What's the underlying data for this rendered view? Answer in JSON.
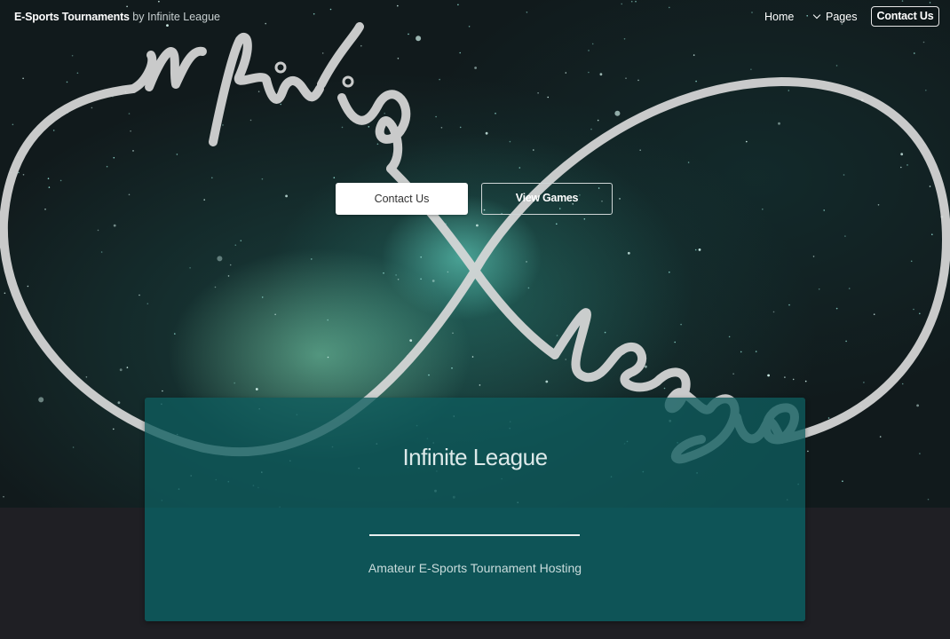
{
  "header": {
    "brand_name": "E-Sports Tournaments",
    "brand_by": "by Infinite League",
    "nav": {
      "home": "Home",
      "pages": "Pages",
      "contact": "Contact Us"
    }
  },
  "hero": {
    "logo_word_top": "infinite",
    "logo_word_bottom": "league",
    "buttons": {
      "contact": "Contact Us",
      "games": "View Games"
    }
  },
  "panel": {
    "title": "Infinite League",
    "subtitle": "Amateur E-Sports Tournament Hosting"
  },
  "colors": {
    "panel": "#0e5c5e",
    "page_bg": "#1f1f24",
    "logo_stroke": "#d9d9d9"
  },
  "icons": {
    "pages_toggle": "chevron-down-icon"
  }
}
